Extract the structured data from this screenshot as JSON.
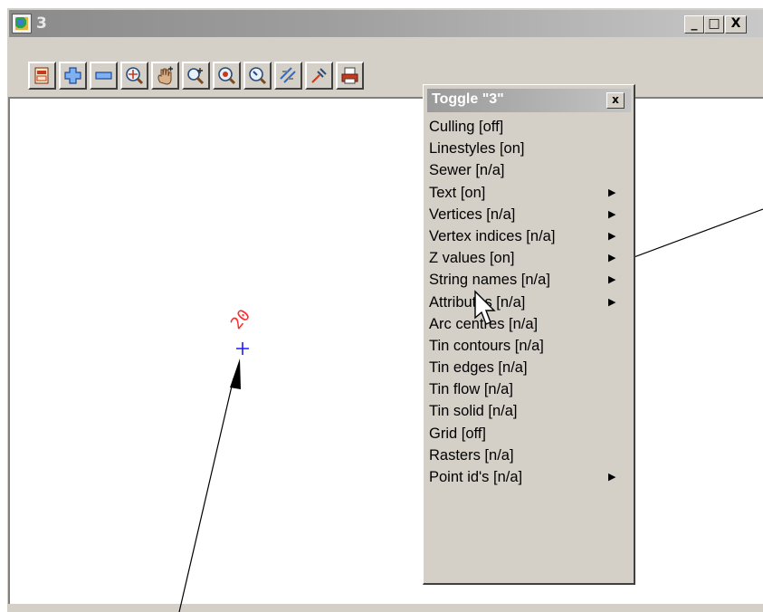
{
  "window": {
    "title": "3"
  },
  "title_controls": {
    "minimize": "_",
    "maximize": "□",
    "close": "X"
  },
  "toolbar": {
    "buttons": [
      {
        "icon": "plot-frame-icon"
      },
      {
        "icon": "zoom-in-plus-icon"
      },
      {
        "icon": "zoom-out-minus-icon"
      },
      {
        "icon": "zoom-extent-icon"
      },
      {
        "icon": "pan-hand-icon"
      },
      {
        "icon": "zoom-window-icon"
      },
      {
        "icon": "zoom-centre-icon"
      },
      {
        "icon": "zoom-previous-icon"
      },
      {
        "icon": "toggle-icon"
      },
      {
        "icon": "pick-icon"
      },
      {
        "icon": "print-icon"
      }
    ]
  },
  "canvas": {
    "point_label": "20",
    "point_marker": "+"
  },
  "popup": {
    "title": "Toggle \"3\"",
    "close_label": "x",
    "items": [
      {
        "label": "Culling [off]",
        "submenu": false
      },
      {
        "label": "Linestyles [on]",
        "submenu": false
      },
      {
        "label": "Sewer [n/a]",
        "submenu": false
      },
      {
        "label": "Text [on]",
        "submenu": true
      },
      {
        "label": "Vertices [n/a]",
        "submenu": true
      },
      {
        "label": "Vertex indices [n/a]",
        "submenu": true
      },
      {
        "label": "Z values [on]",
        "submenu": true
      },
      {
        "label": "String names [n/a]",
        "submenu": true
      },
      {
        "label": "Attributes [n/a]",
        "submenu": true
      },
      {
        "label": "Arc centres [n/a]",
        "submenu": false
      },
      {
        "label": "Tin contours [n/a]",
        "submenu": false
      },
      {
        "label": "Tin edges [n/a]",
        "submenu": false
      },
      {
        "label": "Tin flow [n/a]",
        "submenu": false
      },
      {
        "label": "Tin solid [n/a]",
        "submenu": false
      },
      {
        "label": "Grid [off]",
        "submenu": false
      },
      {
        "label": "Rasters [n/a]",
        "submenu": false
      },
      {
        "label": "Point id's [n/a]",
        "submenu": true
      }
    ]
  },
  "colors": {
    "label_red": "#ff2a2a",
    "marker_blue": "#1a1aff",
    "chrome": "#d4d0c8"
  }
}
